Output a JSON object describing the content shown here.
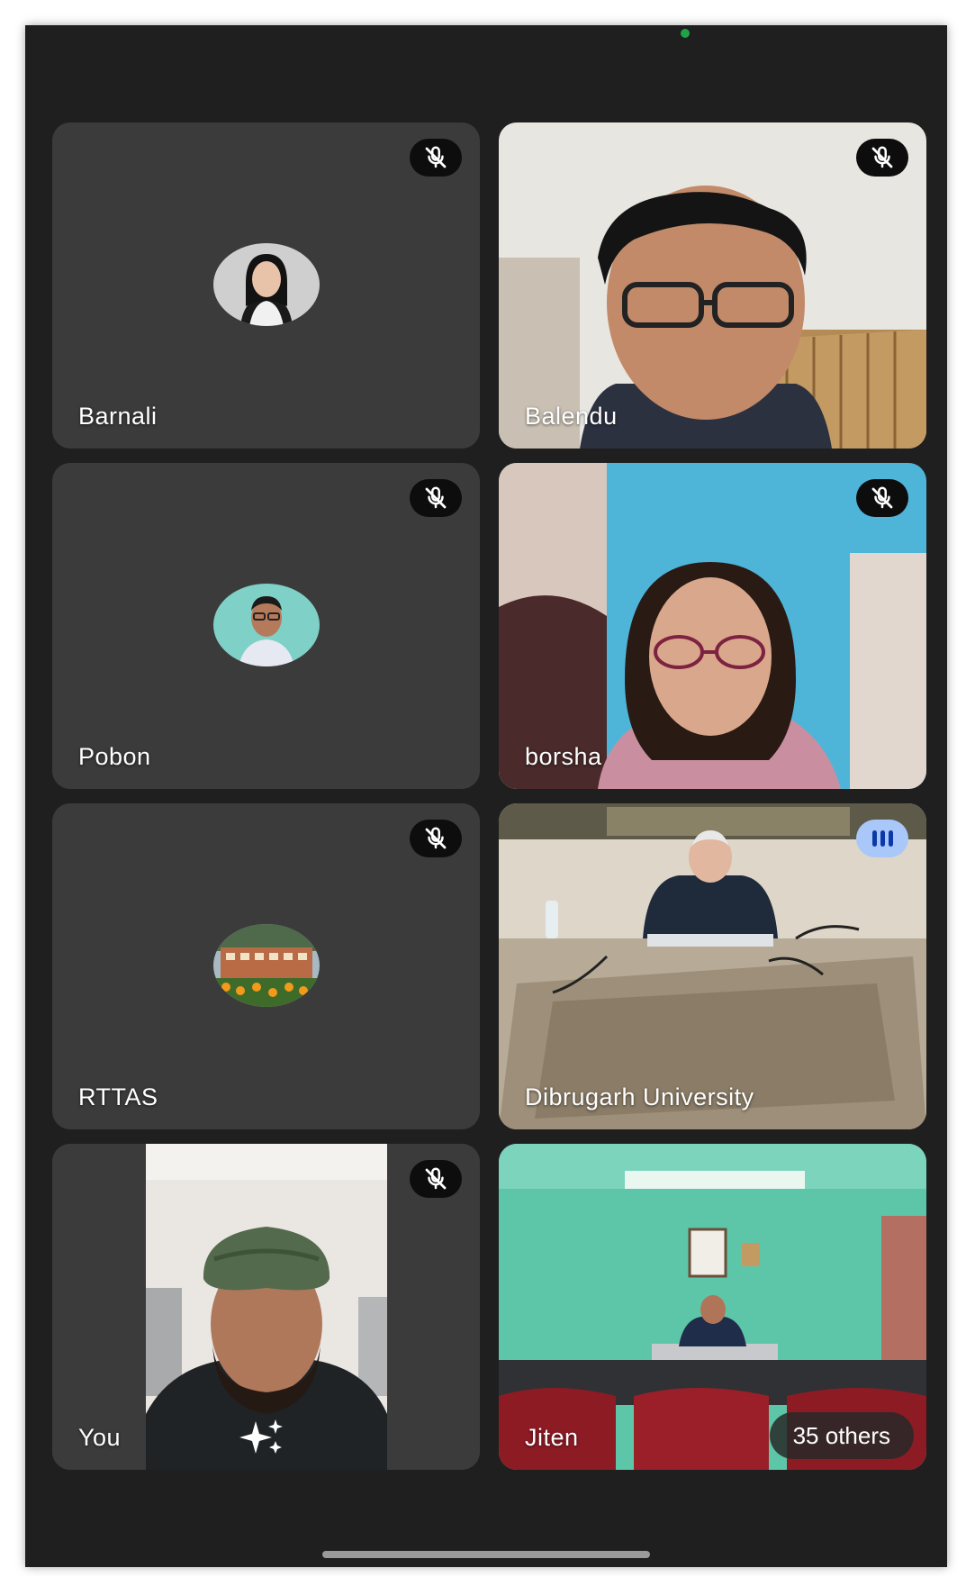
{
  "participants": [
    {
      "name": "Barnali",
      "muted": true,
      "type": "avatar"
    },
    {
      "name": "Balendu",
      "muted": true,
      "type": "video"
    },
    {
      "name": "Pobon",
      "muted": true,
      "type": "avatar"
    },
    {
      "name": "borsha",
      "muted": true,
      "type": "video"
    },
    {
      "name": "RTTAS",
      "muted": true,
      "type": "avatar"
    },
    {
      "name": "Dibrugarh University",
      "muted": false,
      "speaking": true,
      "type": "video"
    },
    {
      "name": "You",
      "muted": true,
      "type": "video"
    },
    {
      "name": "Jiten",
      "muted": false,
      "type": "video"
    }
  ],
  "others_label": "35 others",
  "icons": {
    "mute": "mic-off-icon",
    "speaking": "audio-level-icon",
    "effects": "sparkle-icon"
  },
  "colors": {
    "background": "#1f1f1f",
    "tile": "#3b3b3b",
    "speaking_badge": "#aac7fa",
    "camera_indicator": "#1ea446"
  }
}
